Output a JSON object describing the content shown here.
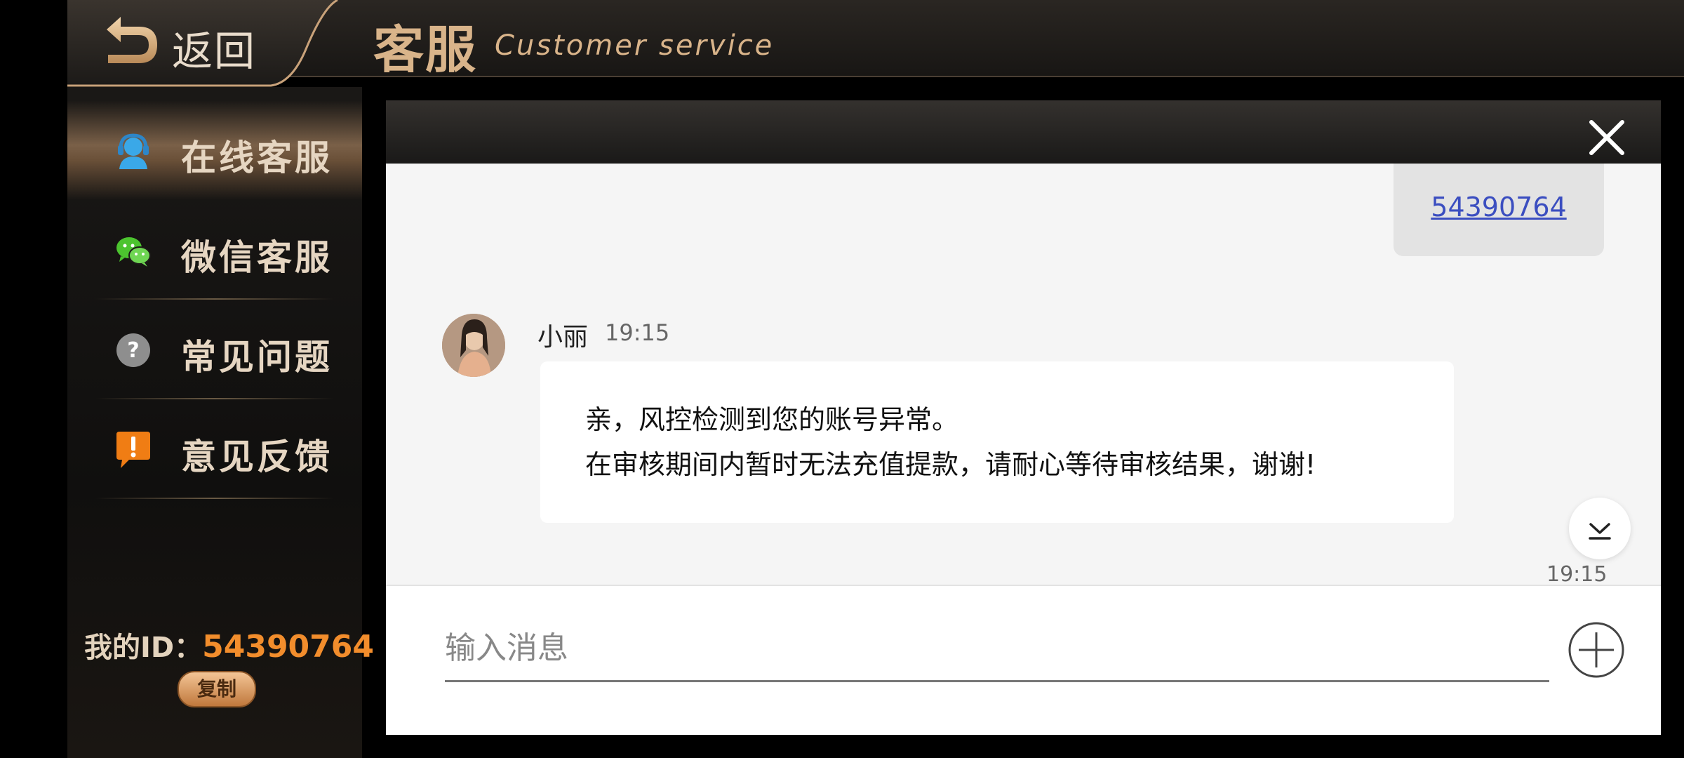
{
  "header": {
    "back_label": "返回",
    "title": "客服",
    "subtitle": "Customer service"
  },
  "sidebar": {
    "items": [
      {
        "label": "在线客服",
        "icon": "headset-icon",
        "active": true
      },
      {
        "label": "微信客服",
        "icon": "wechat-icon",
        "active": false
      },
      {
        "label": "常见问题",
        "icon": "question-icon",
        "active": false
      },
      {
        "label": "意见反馈",
        "icon": "feedback-icon",
        "active": false
      }
    ],
    "my_id_label": "我的ID：",
    "my_id_value": "54390764",
    "copy_label": "复制"
  },
  "chat": {
    "user_message": "54390764",
    "agent": {
      "name": "小丽",
      "time": "19:15",
      "lines": [
        "亲，风控检测到您的账号异常。",
        "在审核期间内暂时无法充值提款，请耐心等待审核结果，谢谢!"
      ]
    },
    "bottom_time": "19:15",
    "input_placeholder": "输入消息"
  },
  "colors": {
    "accent_gold": "#d9b48a",
    "id_orange": "#f28d2c",
    "link_blue": "#3b4ec0"
  }
}
